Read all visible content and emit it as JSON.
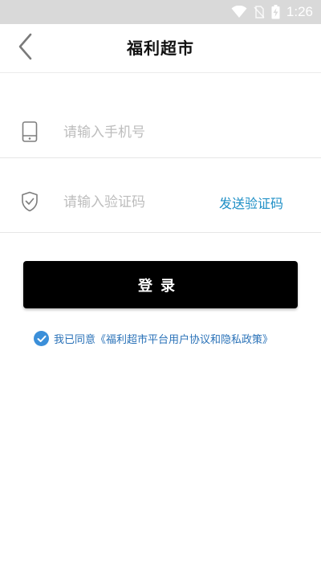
{
  "status_bar": {
    "time": "1:26",
    "icons": [
      "wifi-icon",
      "no-sim-icon",
      "battery-charging-icon"
    ]
  },
  "header": {
    "title": "福利超市",
    "back_icon": "chevron-left-icon"
  },
  "form": {
    "phone": {
      "placeholder": "请输入手机号",
      "value": "",
      "icon": "phone-icon"
    },
    "code": {
      "placeholder": "请输入验证码",
      "value": "",
      "icon": "shield-icon"
    },
    "send_code_label": "发送验证码",
    "login_label": "登录"
  },
  "agreement": {
    "checked": true,
    "text": "我已同意《福利超市平台用户协议和隐私政策》"
  },
  "colors": {
    "accent_link": "#1e8fc6",
    "checkbox": "#3b8fd9",
    "login_button": "#000000",
    "status_bar": "#d9d9d9"
  }
}
